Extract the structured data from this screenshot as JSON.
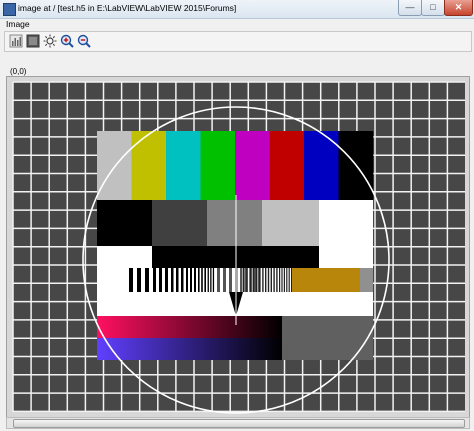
{
  "window": {
    "title": "image  at  /  [test.h5  in  E:\\LabVIEW\\LabVIEW 2015\\Forums]",
    "minimize_label": "—",
    "maximize_label": "□",
    "close_label": "✕"
  },
  "menu": {
    "items": [
      "Image"
    ]
  },
  "toolbar": {
    "tools": [
      "histogram-icon",
      "palette-icon",
      "brightness-icon",
      "zoom-in-icon",
      "zoom-out-icon"
    ]
  },
  "coordinate_readout": "(0,0)",
  "test_pattern": {
    "background": "#474747",
    "grid_line": "#f2f2f2",
    "color_bars": [
      "#c0c0c0",
      "#c0c000",
      "#00c0c0",
      "#00c000",
      "#c000c0",
      "#c00000",
      "#0000c0",
      "#000000"
    ],
    "gray_steps": [
      "#000000",
      "#404040",
      "#808080",
      "#808080",
      "#c0c0c0",
      "#ffffff"
    ],
    "band_color": "#b8860b",
    "gradient_top": [
      "#ff1060",
      "#000000"
    ],
    "gradient_bottom": [
      "#6040ff",
      "#000000"
    ],
    "gray_block": "#606060"
  }
}
